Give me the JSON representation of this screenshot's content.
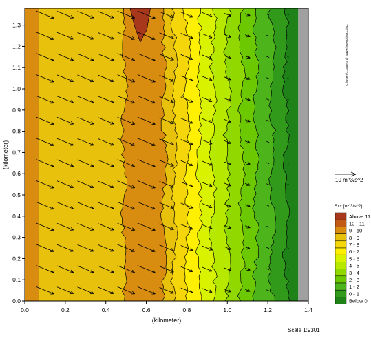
{
  "chart_data": {
    "type": "heatmap",
    "xlabel": "(kilometer)",
    "ylabel": "(kilometer)",
    "xlim": [
      0.0,
      1.4
    ],
    "ylim": [
      0.0,
      1.38
    ],
    "x_ticks": [
      "0.0",
      "0.2",
      "0.4",
      "0.6",
      "0.8",
      "1.0",
      "1.2",
      "1.4"
    ],
    "y_ticks": [
      "0.0",
      "0.1",
      "0.2",
      "0.3",
      "0.4",
      "0.5",
      "0.6",
      "0.7",
      "0.8",
      "0.9",
      "1.0",
      "1.1",
      "1.2",
      "1.3"
    ],
    "x_tick_values": [
      0.0,
      0.2,
      0.4,
      0.6,
      0.8,
      1.0,
      1.2,
      1.4
    ],
    "y_tick_values": [
      0.0,
      0.1,
      0.2,
      0.3,
      0.4,
      0.5,
      0.6,
      0.7,
      0.8,
      0.9,
      1.0,
      1.1,
      1.2,
      1.3
    ],
    "vertical_marker_x": 0.07,
    "bands": [
      {
        "label": "9 - 10",
        "x_from": 0.0,
        "x_to": 0.07
      },
      {
        "label": "8 - 9",
        "x_from": 0.07,
        "x_to": 0.49
      },
      {
        "label": "9 - 10",
        "x_from": 0.49,
        "x_to": 0.69
      },
      {
        "label": "8 - 9",
        "x_from": 0.69,
        "x_to": 0.74
      },
      {
        "label": "7 - 8",
        "x_from": 0.74,
        "x_to": 0.8
      },
      {
        "label": "6 - 7",
        "x_from": 0.8,
        "x_to": 0.86
      },
      {
        "label": "5 - 6",
        "x_from": 0.86,
        "x_to": 0.93
      },
      {
        "label": "4 - 5",
        "x_from": 0.93,
        "x_to": 1.0
      },
      {
        "label": "3 - 4",
        "x_from": 1.0,
        "x_to": 1.07
      },
      {
        "label": "2 - 3",
        "x_from": 1.07,
        "x_to": 1.14
      },
      {
        "label": "1 - 2",
        "x_from": 1.14,
        "x_to": 1.22
      },
      {
        "label": "0 - 1",
        "x_from": 1.22,
        "x_to": 1.29
      },
      {
        "label": "Below 0",
        "x_from": 1.29,
        "x_to": 1.35
      }
    ],
    "hot_spot": {
      "label": "Above 11",
      "x_from": 0.52,
      "x_to": 0.62,
      "y_from": 1.22,
      "y_to": 1.38
    },
    "land": {
      "x_from": 1.35,
      "x_to": 1.4,
      "color": "#a0a0a0"
    },
    "vector_field": {
      "x_positions": [
        0.1,
        0.2,
        0.3,
        0.4,
        0.5,
        0.6,
        0.7,
        0.8,
        0.9,
        1.0,
        1.1,
        1.2,
        1.3
      ],
      "y_positions": [
        0.05,
        0.15,
        0.25,
        0.35,
        0.45,
        0.55,
        0.65,
        0.75,
        0.85,
        0.95,
        1.05,
        1.15,
        1.25,
        1.35
      ],
      "magnitudes_m3_per_s2": [
        9.2,
        8.5,
        8.5,
        8.3,
        9.0,
        9.2,
        7.5,
        6.3,
        5.2,
        3.8,
        2.6,
        1.4,
        0.5
      ],
      "direction_deg_below_east": 22
    },
    "vector_scale": {
      "label": "10 m^3/s^2",
      "value": 10
    },
    "legend_position": "right",
    "legend": {
      "title": "Sxx [m^3/s^2]",
      "items": [
        {
          "label": "Above 11",
          "color": "#a8381b"
        },
        {
          "label": "10 - 11",
          "color": "#c15a14"
        },
        {
          "label": "9 - 10",
          "color": "#d98d10"
        },
        {
          "label": "8 - 9",
          "color": "#e8c10d"
        },
        {
          "label": "7 - 8",
          "color": "#f4d60a"
        },
        {
          "label": "6 - 7",
          "color": "#ffef00"
        },
        {
          "label": "5 - 6",
          "color": "#d9f200"
        },
        {
          "label": "4 - 5",
          "color": "#b7e800"
        },
        {
          "label": "3 - 4",
          "color": "#91d800"
        },
        {
          "label": "2 - 3",
          "color": "#6cc800"
        },
        {
          "label": "1 - 2",
          "color": "#4db41b"
        },
        {
          "label": "0 - 1",
          "color": "#329a1b"
        },
        {
          "label": "Below 0",
          "color": "#1f8219"
        }
      ]
    },
    "side_text": "C:\\Users\\...\\Spectral Waves\\Result\\Sxx.dfs2",
    "scale_text": "Scale 1:9301"
  }
}
